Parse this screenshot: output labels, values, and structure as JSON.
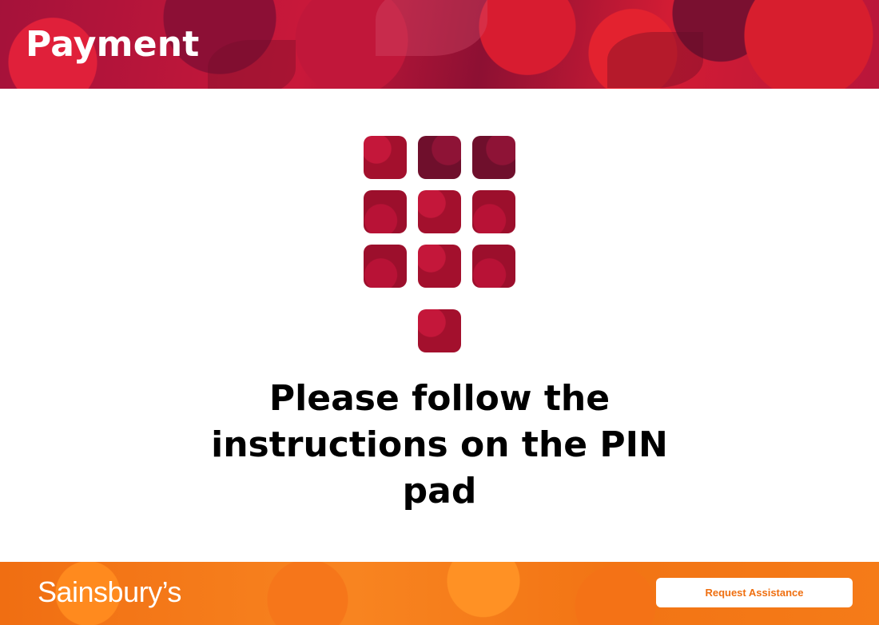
{
  "header": {
    "title": "Payment"
  },
  "keypad": {
    "icon": "pin-pad-keypad-icon"
  },
  "main": {
    "message": "Please follow the instructions on the PIN pad"
  },
  "footer": {
    "brand": "Sainsbury’s",
    "assist_label": "Request Assistance"
  },
  "colors": {
    "header_red": "#c9183a",
    "footer_orange": "#f57b18",
    "accent_text": "#ef6f10"
  }
}
